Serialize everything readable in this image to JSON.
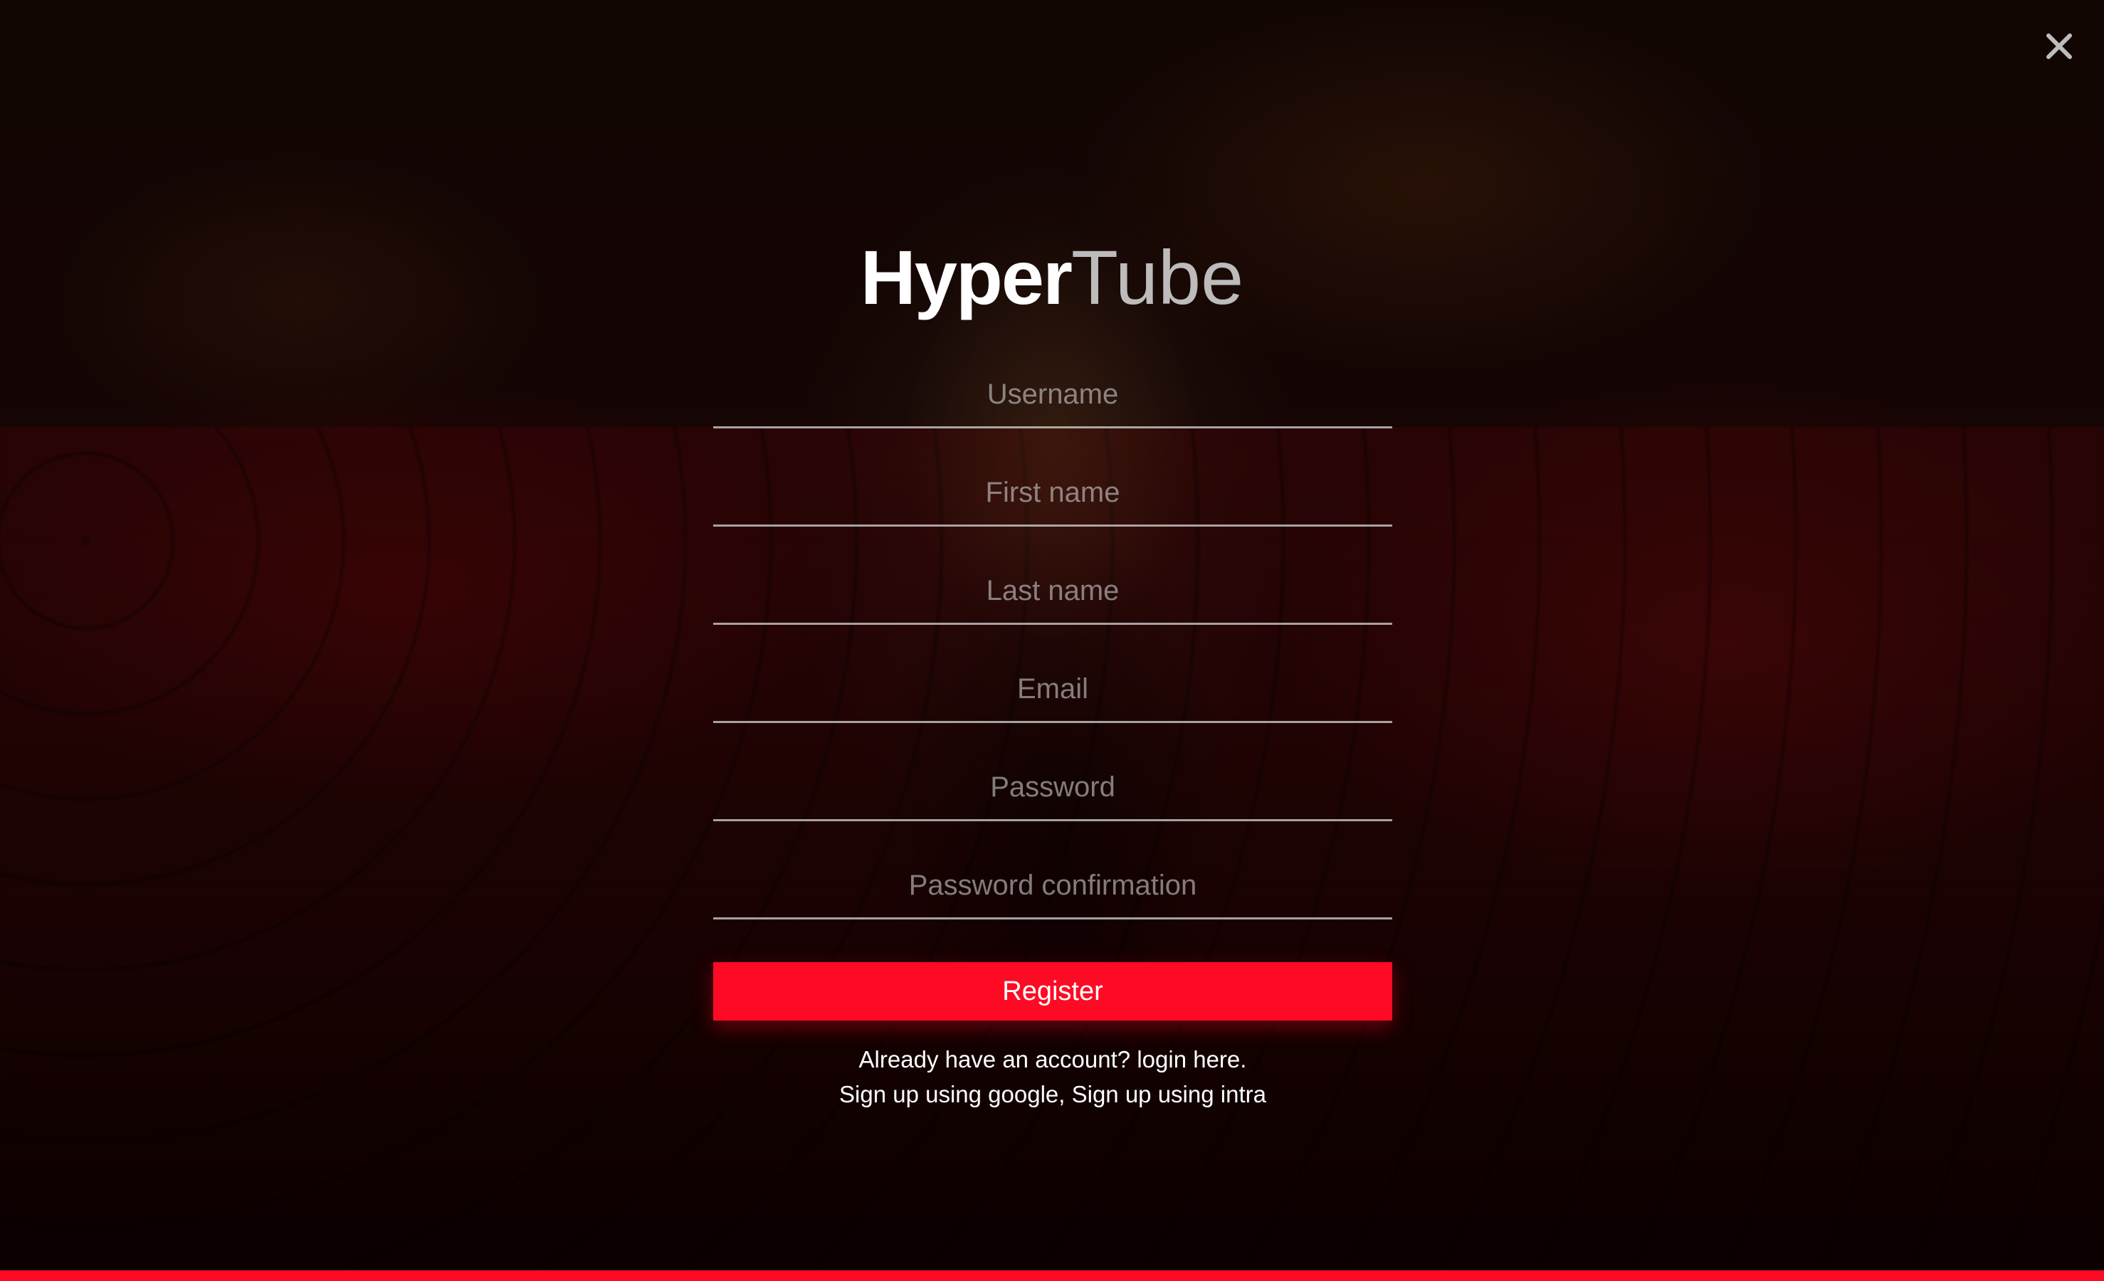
{
  "app": {
    "logo_bold": "Hyper",
    "logo_light": "Tube",
    "accent_color": "#ff0a25"
  },
  "close_icon": "close-icon",
  "form": {
    "fields": {
      "username": {
        "placeholder": "Username",
        "value": ""
      },
      "first_name": {
        "placeholder": "First name",
        "value": ""
      },
      "last_name": {
        "placeholder": "Last name",
        "value": ""
      },
      "email": {
        "placeholder": "Email",
        "value": ""
      },
      "password": {
        "placeholder": "Password",
        "value": ""
      },
      "password_confirmation": {
        "placeholder": "Password confirmation",
        "value": ""
      }
    },
    "register_label": "Register"
  },
  "links": {
    "already_account": "Already have an account?",
    "login_here": "login here.",
    "signup_google": "Sign up using google,",
    "signup_intra": "Sign up using intra"
  }
}
